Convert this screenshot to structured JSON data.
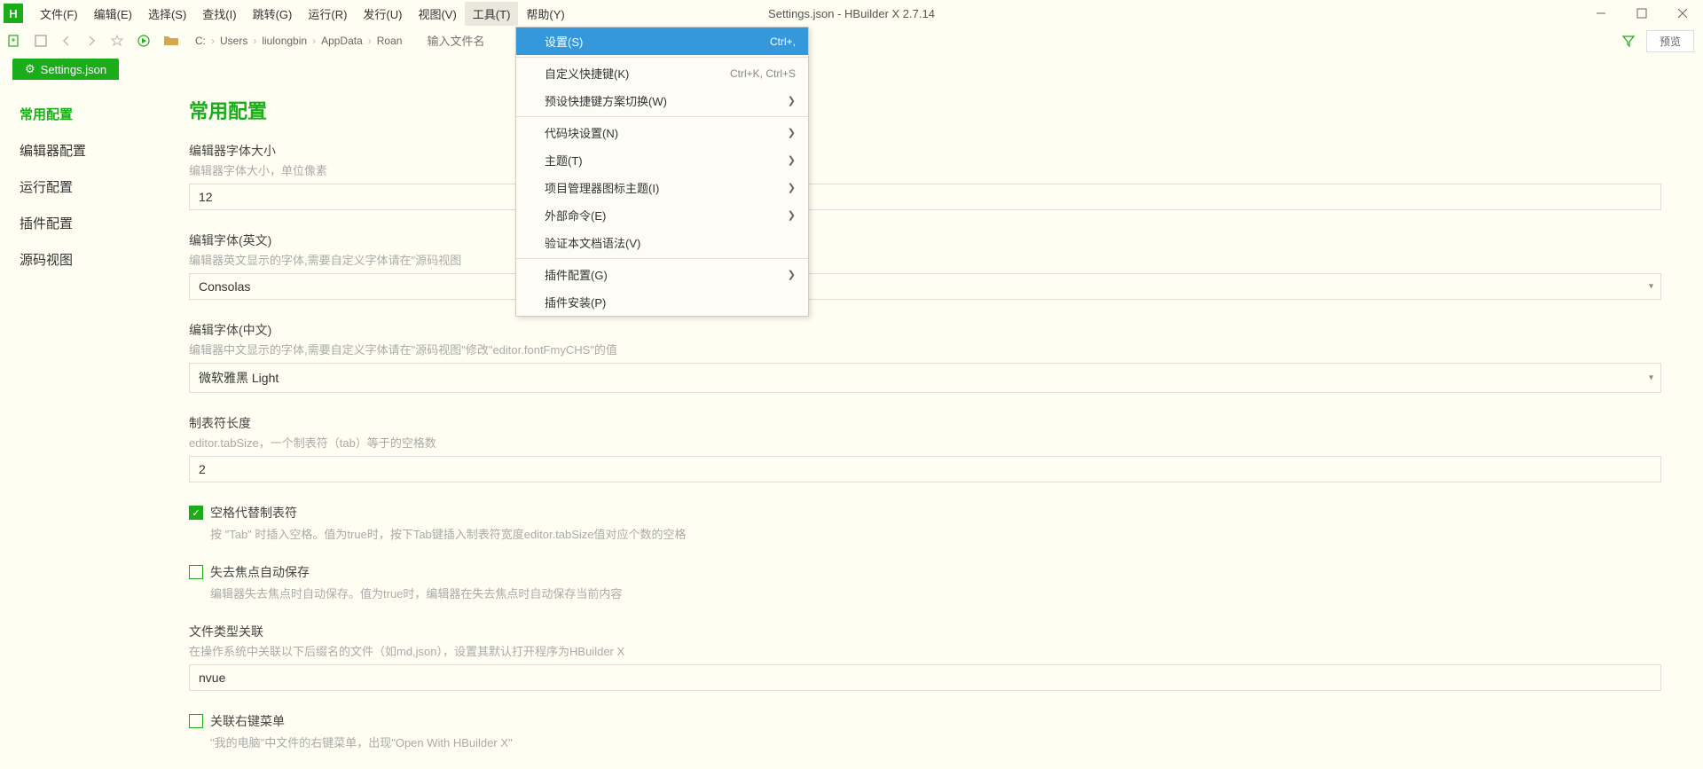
{
  "app": {
    "icon_letter": "H",
    "title": "Settings.json - HBuilder X 2.7.14"
  },
  "menubar": [
    {
      "label": "文件(F)"
    },
    {
      "label": "编辑(E)"
    },
    {
      "label": "选择(S)"
    },
    {
      "label": "查找(I)"
    },
    {
      "label": "跳转(G)"
    },
    {
      "label": "运行(R)"
    },
    {
      "label": "发行(U)"
    },
    {
      "label": "视图(V)"
    },
    {
      "label": "工具(T)",
      "active": true
    },
    {
      "label": "帮助(Y)"
    }
  ],
  "dropdown": {
    "groups": [
      [
        {
          "label": "设置(S)",
          "shortcut": "Ctrl+,",
          "highlighted": true
        }
      ],
      [
        {
          "label": "自定义快捷键(K)",
          "shortcut": "Ctrl+K, Ctrl+S"
        },
        {
          "label": "预设快捷键方案切换(W)",
          "submenu": true
        }
      ],
      [
        {
          "label": "代码块设置(N)",
          "submenu": true
        },
        {
          "label": "主题(T)",
          "submenu": true
        },
        {
          "label": "项目管理器图标主题(I)",
          "submenu": true
        },
        {
          "label": "外部命令(E)",
          "submenu": true
        },
        {
          "label": "验证本文档语法(V)"
        }
      ],
      [
        {
          "label": "插件配置(G)",
          "submenu": true
        },
        {
          "label": "插件安装(P)"
        }
      ]
    ]
  },
  "breadcrumb": [
    "C:",
    "Users",
    "liulongbin",
    "AppData",
    "Roan"
  ],
  "search": {
    "placeholder": "输入文件名"
  },
  "toolbar_right": {
    "preview": "预览"
  },
  "tab": {
    "label": "Settings.json"
  },
  "sidebar": [
    {
      "label": "常用配置",
      "active": true
    },
    {
      "label": "编辑器配置"
    },
    {
      "label": "运行配置"
    },
    {
      "label": "插件配置"
    },
    {
      "label": "源码视图"
    }
  ],
  "content": {
    "title": "常用配置",
    "fields": {
      "fontSize": {
        "label": "编辑器字体大小",
        "desc": "编辑器字体大小，单位像素",
        "value": "12"
      },
      "fontEn": {
        "label": "编辑字体(英文)",
        "desc": "编辑器英文显示的字体,需要自定义字体请在\"源码视图",
        "value": "Consolas"
      },
      "fontZh": {
        "label": "编辑字体(中文)",
        "desc": "编辑器中文显示的字体,需要自定义字体请在\"源码视图\"修改\"editor.fontFmyCHS\"的值",
        "value": "微软雅黑 Light"
      },
      "tabSize": {
        "label": "制表符长度",
        "desc": "editor.tabSize，一个制表符（tab）等于的空格数",
        "value": "2"
      },
      "spaces": {
        "label": "空格代替制表符",
        "desc": "按 \"Tab\" 时插入空格。值为true时，按下Tab键插入制表符宽度editor.tabSize值对应个数的空格",
        "checked": true
      },
      "autoSave": {
        "label": "失去焦点自动保存",
        "desc": "编辑器失去焦点时自动保存。值为true时，编辑器在失去焦点时自动保存当前内容",
        "checked": false
      },
      "fileAssoc": {
        "label": "文件类型关联",
        "desc": "在操作系统中关联以下后缀名的文件（如md,json），设置其默认打开程序为HBuilder X",
        "value": "nvue"
      },
      "contextMenu": {
        "label": "关联右键菜单",
        "desc": "\"我的电脑\"中文件的右键菜单，出现\"Open With HBuilder X\"",
        "checked": false
      }
    }
  }
}
